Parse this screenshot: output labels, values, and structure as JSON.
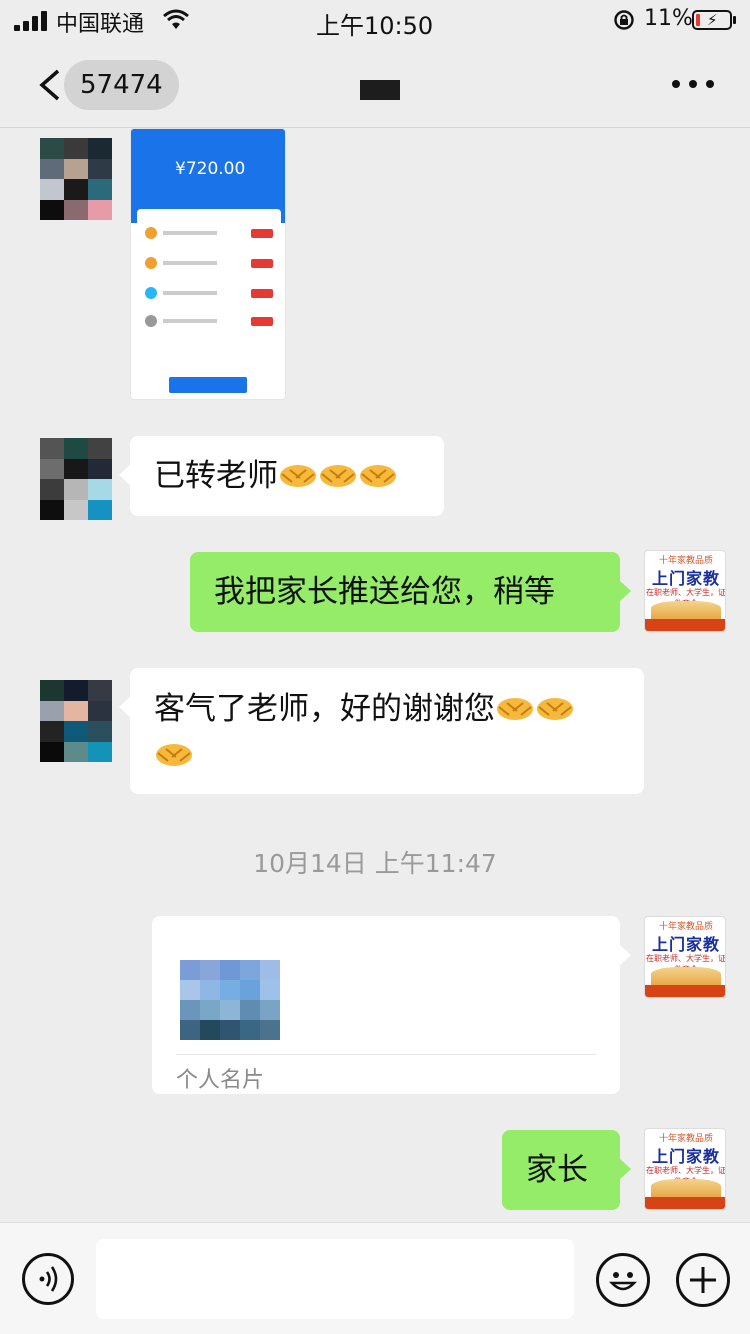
{
  "status_bar": {
    "carrier": "中国联通",
    "time": "上午10:50",
    "battery": "11%",
    "battery_level": 0.11
  },
  "nav": {
    "unread_count": "57474"
  },
  "messages": [
    {
      "side": "left",
      "kind": "image",
      "image_amount": "¥720.00"
    },
    {
      "side": "left",
      "kind": "text",
      "text": "已转老师",
      "emoji": [
        "handshake",
        "handshake",
        "handshake"
      ]
    },
    {
      "side": "right",
      "kind": "text",
      "text": "我把家长推送给您，稍等"
    },
    {
      "side": "left",
      "kind": "text",
      "text": "客气了老师，好的谢谢您",
      "emoji": [
        "handshake",
        "handshake",
        "handshake"
      ]
    },
    {
      "kind": "timestamp",
      "text": "10月14日 上午11:47"
    },
    {
      "side": "right",
      "kind": "contact_card",
      "label": "个人名片"
    },
    {
      "side": "right",
      "kind": "text",
      "text": "家长"
    }
  ],
  "my_avatar": {
    "top_line": "十年家教品质",
    "brand": "上门家教",
    "slogan": "在职老师、大学生，证件齐全"
  },
  "colors": {
    "background": "#ededed",
    "my_bubble": "#95ec69",
    "their_bubble": "#ffffff"
  }
}
